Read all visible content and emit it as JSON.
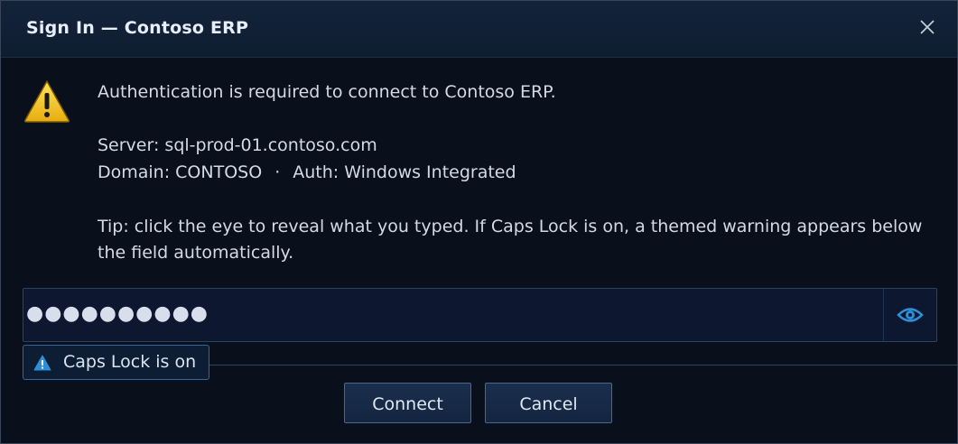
{
  "window": {
    "title": "Sign In — Contoso ERP",
    "close_icon": "close-icon"
  },
  "message": {
    "icon": "warning-icon",
    "text": "Authentication is required to connect to Contoso ERP.",
    "server": "Server:  sql-prod-01.contoso.com",
    "domain": "Domain:  CONTOSO",
    "separator": "·",
    "auth": "Auth: Windows Integrated",
    "tip": "Tip: click the eye to reveal what you typed. If Caps Lock is on, a themed warning appears below the field automatically."
  },
  "password": {
    "masked_value": "●●●●●●●●●●",
    "reveal_icon": "eye-icon"
  },
  "caps_lock": {
    "icon": "warning-icon",
    "text": "Caps Lock is on"
  },
  "buttons": {
    "connect": "Connect",
    "cancel": "Cancel"
  },
  "colors": {
    "background": "#0a0f1c",
    "titlebar": "#13233a",
    "warning_yellow": "#f2c21b",
    "accent_blue": "#2f8fd6"
  }
}
